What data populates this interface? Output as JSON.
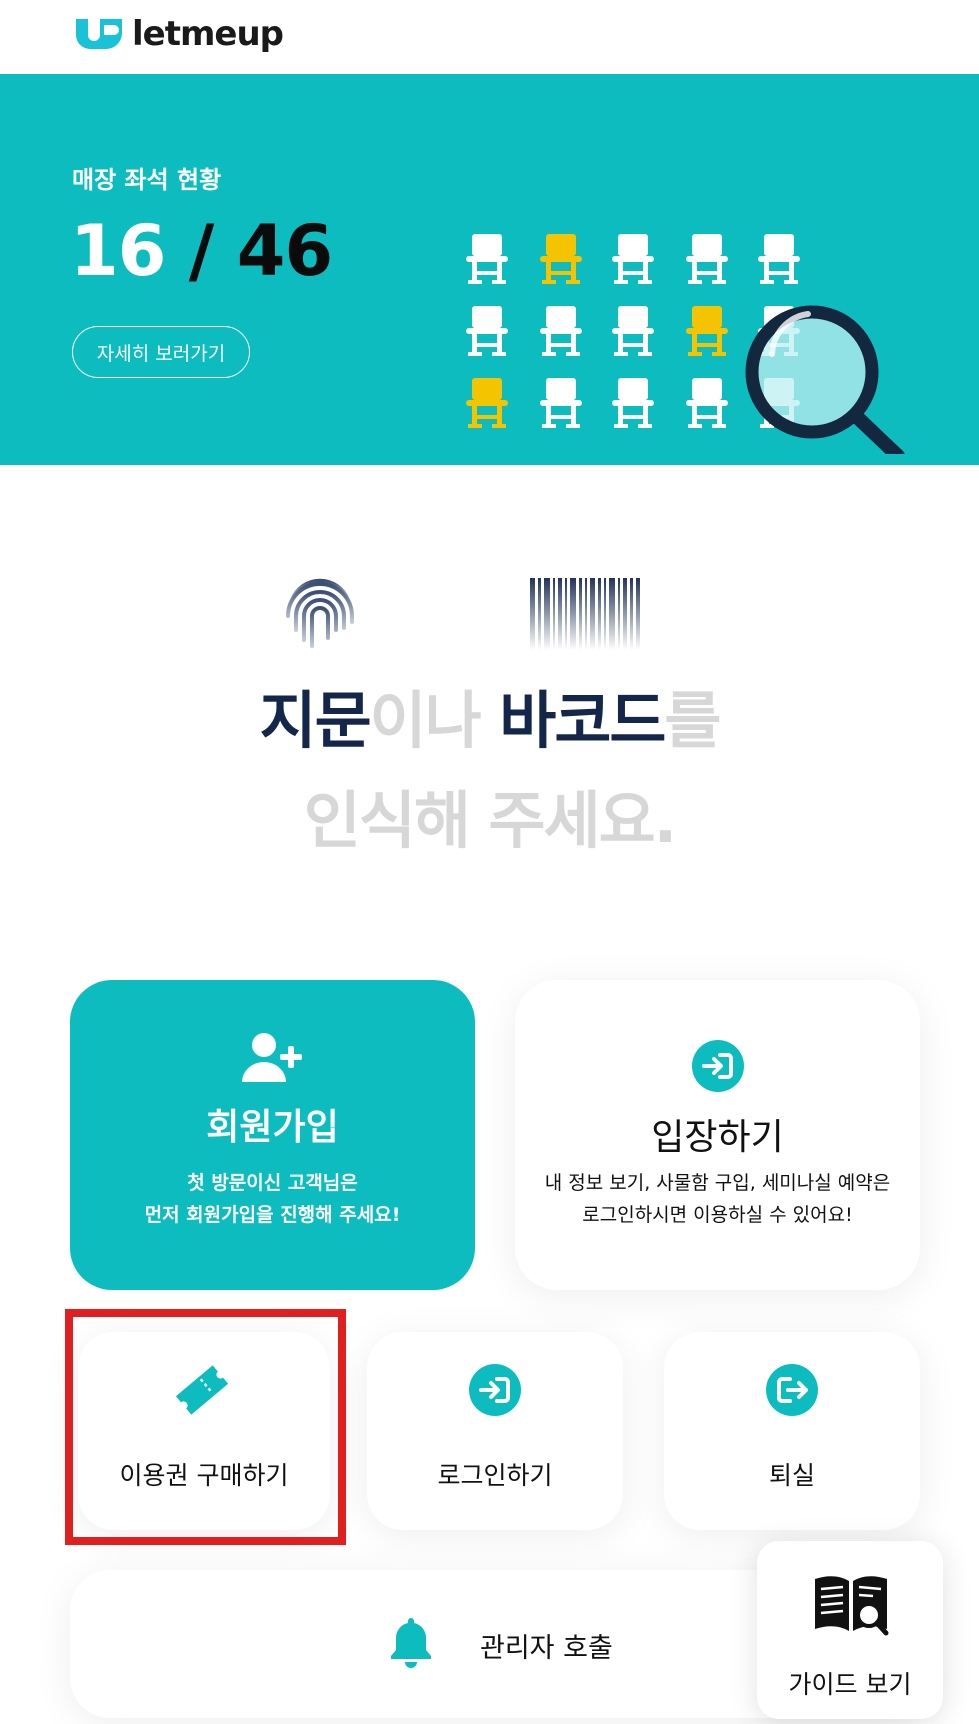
{
  "header": {
    "logo_text": "letmeup",
    "logo_icon": "letmeup-logo-icon",
    "brand_color": "#0cbcbe"
  },
  "banner": {
    "label": "매장 좌석 현황",
    "seats_used": "16",
    "separator": "/",
    "seats_total": "46",
    "detail_button": "자세히 보러가기",
    "illustration_icon": "seat-magnifier-illustration",
    "background_color": "#0cbcbe",
    "highlight_seat_color": "#f5c400"
  },
  "recognition": {
    "fingerprint_icon": "fingerprint-icon",
    "barcode_icon": "barcode-icon",
    "line1": [
      "지문",
      "이나 ",
      "바코드",
      "를"
    ],
    "line2": "인식해 주세요."
  },
  "cards": {
    "signup": {
      "title": "회원가입",
      "desc_line1": "첫 방문이신 고객님은",
      "desc_line2": "먼저 회원가입을 진행해 주세요!",
      "icon": "user-plus-icon"
    },
    "enter": {
      "title": "입장하기",
      "desc_line1": "내 정보 보기, 사물함 구입, 세미나실 예약은",
      "desc_line2": "로그인하시면 이용하실 수 있어요!",
      "icon": "sign-in-icon"
    },
    "ticket": {
      "label": "이용권 구매하기",
      "icon": "ticket-icon"
    },
    "login": {
      "label": "로그인하기",
      "icon": "sign-in-icon"
    },
    "checkout": {
      "label": "퇴실",
      "icon": "sign-out-icon"
    },
    "call": {
      "label": "관리자 호출",
      "icon": "bell-icon"
    },
    "guide": {
      "label": "가이드 보기",
      "icon": "book-search-icon"
    }
  }
}
